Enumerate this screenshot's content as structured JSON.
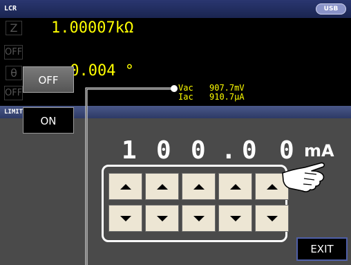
{
  "header": {
    "mode_title": "LCR",
    "usb_badge": "USB"
  },
  "measurement": {
    "param1": "Z",
    "param1_value": "1.00007kΩ",
    "param2": "OFF",
    "param3": "θ",
    "param3_value": "-0.004 °",
    "param4": "OFF"
  },
  "monitor": {
    "voltage_label": "Vac",
    "voltage_value": "907.7mV",
    "current_label": "Iac",
    "current_value": "910.7μA"
  },
  "limit_panel": {
    "title": "LIMIT",
    "off_label": "OFF",
    "on_label": "ON",
    "digits": [
      "1",
      "0",
      "0",
      "0",
      "0"
    ],
    "decimal_point": ".",
    "unit": "mA",
    "exit_label": "EXIT"
  },
  "icons": {
    "increment": "triangle-up-icon",
    "decrement": "triangle-down-icon",
    "pointer": "pointing-hand-icon"
  },
  "colors": {
    "value_text": "#ffff00",
    "panel_bg": "#4a4a4a",
    "header_bg": "#2a3670",
    "step_button": "#ede6d4",
    "exit_border": "#4f5fa8"
  }
}
